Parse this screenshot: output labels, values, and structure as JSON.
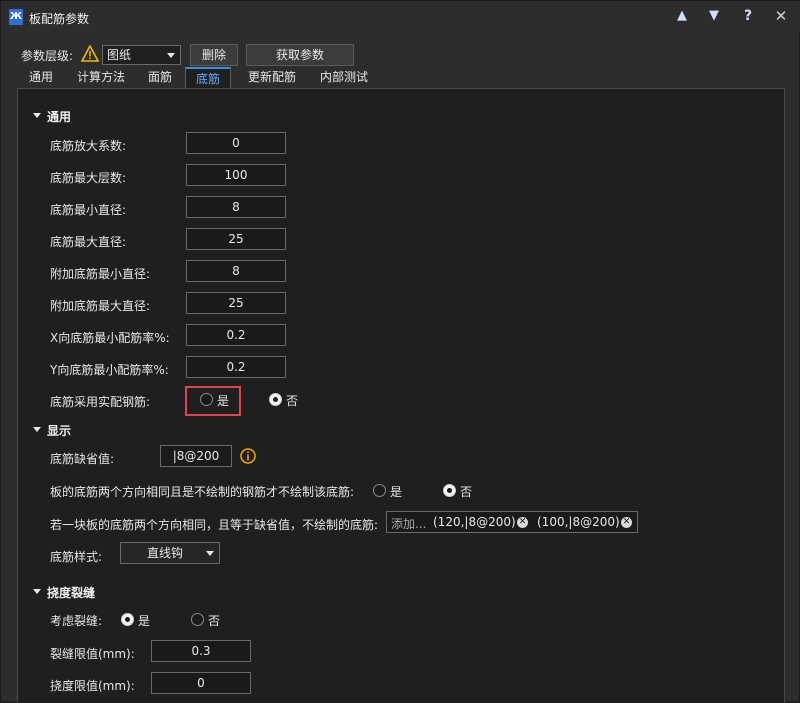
{
  "window": {
    "title": "板配筋参数",
    "app_icon": "structure-app-icon"
  },
  "titlebar_buttons": {
    "up": "▲",
    "down": "▼",
    "help": "?",
    "close": "✕"
  },
  "toolbar": {
    "level_label": "参数层级:",
    "level_value": "图纸",
    "delete_label": "删除",
    "fetch_label": "获取参数"
  },
  "tabs": [
    {
      "label": "通用"
    },
    {
      "label": "计算方法"
    },
    {
      "label": "面筋"
    },
    {
      "label": "底筋"
    },
    {
      "label": "更新配筋"
    },
    {
      "label": "内部测试"
    }
  ],
  "active_tab": "底筋",
  "general": {
    "heading": "通用",
    "rows": [
      {
        "label": "底筋放大系数:",
        "value": "0"
      },
      {
        "label": "底筋最大层数:",
        "value": "100"
      },
      {
        "label": "底筋最小直径:",
        "value": "8"
      },
      {
        "label": "底筋最大直径:",
        "value": "25"
      },
      {
        "label": "附加底筋最小直径:",
        "value": "8"
      },
      {
        "label": "附加底筋最大直径:",
        "value": "25"
      },
      {
        "label": "X向底筋最小配筋率%:",
        "value": "0.2"
      },
      {
        "label": "Y向底筋最小配筋率%:",
        "value": "0.2"
      }
    ],
    "actual_bar": {
      "label": "底筋采用实配钢筋:",
      "yes": "是",
      "no": "否",
      "selected": "否"
    }
  },
  "display": {
    "heading": "显示",
    "default_label": "底筋缺省值:",
    "default_value": "|8@200",
    "same_dir": {
      "label": "板的底筋两个方向相同且是不绘制的钢筋才不绘制该底筋:",
      "yes": "是",
      "no": "否",
      "selected": "否"
    },
    "skip_draw": {
      "label": "若一块板的底筋两个方向相同，且等于缺省值，不绘制的底筋:",
      "placeholder": "添加...",
      "tags": [
        "(120,|8@200)",
        "(100,|8@200)"
      ]
    },
    "style_label": "底筋样式:",
    "style_value": "直线钩"
  },
  "crack": {
    "heading": "挠度裂缝",
    "consider": {
      "label": "考虑裂缝:",
      "yes": "是",
      "no": "否",
      "selected": "是"
    },
    "crack_limit_label": "裂缝限值(mm):",
    "crack_limit_value": "0.3",
    "deflection_limit_label": "挠度限值(mm):",
    "deflection_limit_value": "0"
  },
  "colors": {
    "active_tab": "#5fb0ff",
    "highlight": "#e04545",
    "warning": "#f2b705",
    "info": "#f2a400"
  }
}
